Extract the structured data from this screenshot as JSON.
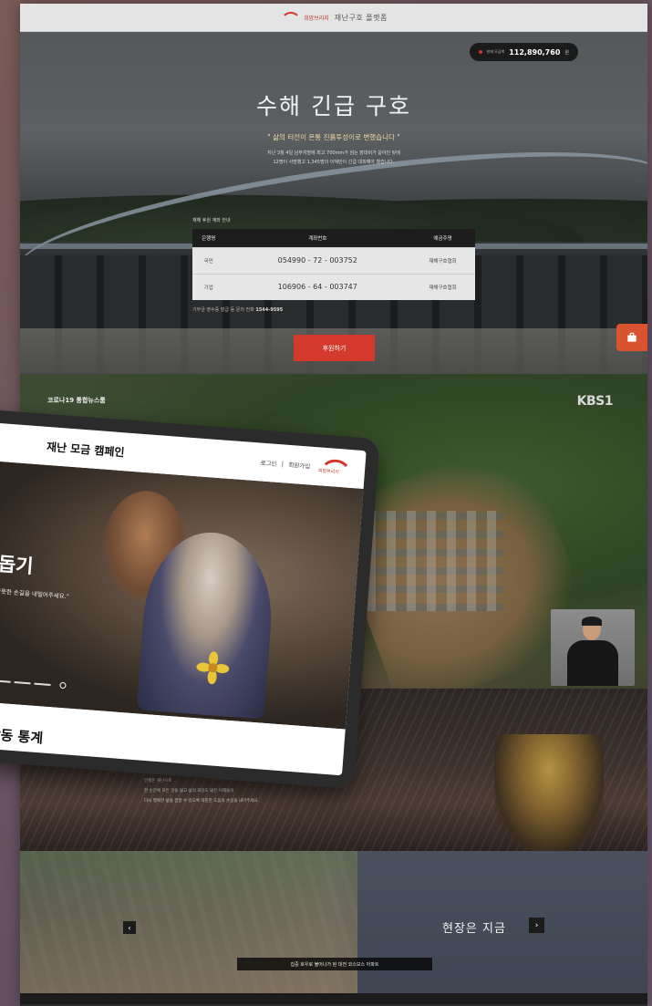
{
  "site": {
    "logo_text": "희망브리지",
    "title": "재난구호 플랫폼"
  },
  "hero": {
    "amount_label": "현재 모금액",
    "amount_value": "112,890,760",
    "amount_unit": "원",
    "title": "수해 긴급 구호",
    "quote": "\" 삶의 터전이 온통 진흙투성이로 변했습니다 \"",
    "desc_line1": "지난 3월 4일 남부지방에 최고 700mm가 넘는 장대비가 쏟아진 탓에",
    "desc_line2": "12명이 사망했고 1,345명의 이재민이 긴급 대피해야 했습니다.",
    "account_caption": "재해 후원 계좌 안내",
    "table_headers": [
      "은행명",
      "계좌번호",
      "예금주명"
    ],
    "accounts": [
      {
        "bank": "국민",
        "number": "054990 - 72 - 003752",
        "holder": "재해구호협회"
      },
      {
        "bank": "기업",
        "number": "106906 - 64 - 003747",
        "holder": "재해구호협회"
      }
    ],
    "note_prefix": "기부금 영수증 발급 등 문의 전화",
    "note_phone": "1544-9595",
    "donate_button": "후원하기"
  },
  "news": {
    "caption": "코로나19 통합뉴스룸",
    "broadcaster": "KBS1"
  },
  "tablet": {
    "title": "재난 모금 캠페인",
    "login": "로그인",
    "signup": "회원가입",
    "logo_text": "희망브리지",
    "headline_line1": "라",
    "headline_line2": "나 돕기",
    "sub": "민들에게 따뜻한 손길을 내밀어주세요.\"",
    "section_title": "구호활동 통계"
  },
  "story": {
    "line1": "언제든 재난으로 ...",
    "line2": "한 순간에 모든 것을 잃고 삶의 희망도 잃은 이재들이",
    "line3": "다시 행복한 삶을 꿈꿀 수 있도록 따뜻한 도움의 손길을 내미주세요"
  },
  "gallery": {
    "title": "현장은 지금",
    "caption": "집중 호우로 불어나가 된 대전 코스모스 아파트"
  },
  "colors": {
    "accent": "#d33a2c",
    "dark": "#1b1b1b"
  }
}
